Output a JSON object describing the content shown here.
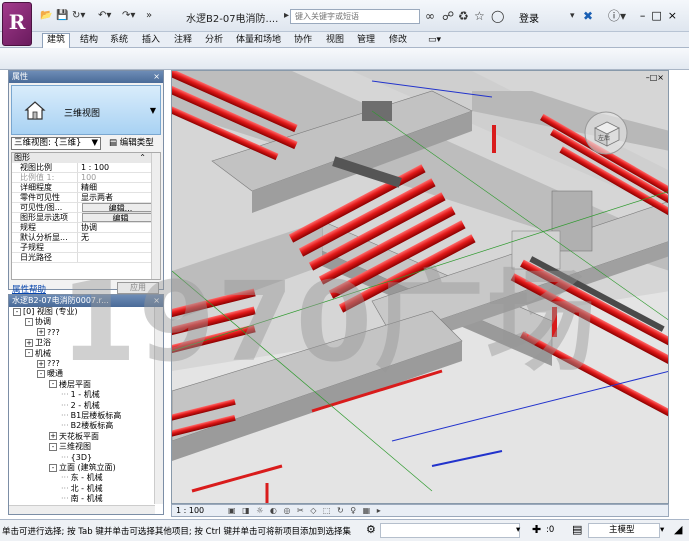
{
  "app": {
    "logo_letter": "R",
    "document_title": "水逻B2-07电消防....",
    "search_placeholder": "键入关键字或短语",
    "login_label": "登录",
    "quick_access_more": "»"
  },
  "ribbon": {
    "tabs": [
      "建筑",
      "结构",
      "系统",
      "插入",
      "注释",
      "分析",
      "体量和场地",
      "协作",
      "视图",
      "管理",
      "修改"
    ],
    "active_tab": "建筑"
  },
  "properties": {
    "panel_title": "属性",
    "type_name": "三维视图",
    "view_selector": "三维视图: {三维}",
    "edit_type": "编辑类型",
    "category": "图形",
    "rows": [
      {
        "key": "视图比例",
        "value": "1 : 100",
        "dim": false
      },
      {
        "key": "比例值 1:",
        "value": "100",
        "dim": true
      },
      {
        "key": "详细程度",
        "value": "精细",
        "dim": false
      },
      {
        "key": "零件可见性",
        "value": "显示两者",
        "dim": false
      },
      {
        "key": "可见性/图...",
        "value": "编辑...",
        "dim": false,
        "button": true
      },
      {
        "key": "图形显示选项",
        "value": "编辑",
        "dim": false,
        "button": true
      },
      {
        "key": "规程",
        "value": "协调",
        "dim": false
      },
      {
        "key": "默认分析显...",
        "value": "无",
        "dim": false
      },
      {
        "key": "子规程",
        "value": "",
        "dim": false
      },
      {
        "key": "日光路径",
        "value": "",
        "dim": false
      }
    ],
    "help_link": "属性帮助",
    "apply_label": "应用"
  },
  "browser": {
    "panel_title": "水逻B2-07电消防0007.r...",
    "nodes": [
      {
        "level": 0,
        "toggle": "-",
        "label": "[0] 视图 (专业)"
      },
      {
        "level": 1,
        "toggle": "-",
        "label": "协调"
      },
      {
        "level": 2,
        "toggle": "+",
        "label": "???"
      },
      {
        "level": 1,
        "toggle": "+",
        "label": "卫浴"
      },
      {
        "level": 1,
        "toggle": "-",
        "label": "机械"
      },
      {
        "level": 2,
        "toggle": "+",
        "label": "???"
      },
      {
        "level": 2,
        "toggle": "-",
        "label": "暖通"
      },
      {
        "level": 3,
        "toggle": "-",
        "label": "楼层平面"
      },
      {
        "level": 4,
        "toggle": "",
        "label": "1 - 机械"
      },
      {
        "level": 4,
        "toggle": "",
        "label": "2 - 机械"
      },
      {
        "level": 4,
        "toggle": "",
        "label": "B1层楼板标高"
      },
      {
        "level": 4,
        "toggle": "",
        "label": "B2楼板标高"
      },
      {
        "level": 3,
        "toggle": "+",
        "label": "天花板平面"
      },
      {
        "level": 3,
        "toggle": "-",
        "label": "三维视图"
      },
      {
        "level": 4,
        "toggle": "",
        "label": "{3D}"
      },
      {
        "level": 3,
        "toggle": "-",
        "label": "立面 (建筑立面)"
      },
      {
        "level": 4,
        "toggle": "",
        "label": "东 - 机械"
      },
      {
        "level": 4,
        "toggle": "",
        "label": "北 - 机械"
      },
      {
        "level": 4,
        "toggle": "",
        "label": "南 - 机械"
      }
    ]
  },
  "viewport": {
    "view_cube_label": "左后"
  },
  "viewbar": {
    "scale": "1 : 100"
  },
  "status": {
    "text": "单击可进行选择; 按 Tab 键并单击可选择其他项目; 按 Ctrl 键并单击可将新项目添加到选择集",
    "count": ":0",
    "model_label": "主模型"
  },
  "watermark": "1970广场",
  "colors": {
    "pipe": "#d91c1c",
    "concrete": "#c8c8c8",
    "ribbon_bg": "#e9eef5",
    "panel_header": "#4a6b98"
  }
}
